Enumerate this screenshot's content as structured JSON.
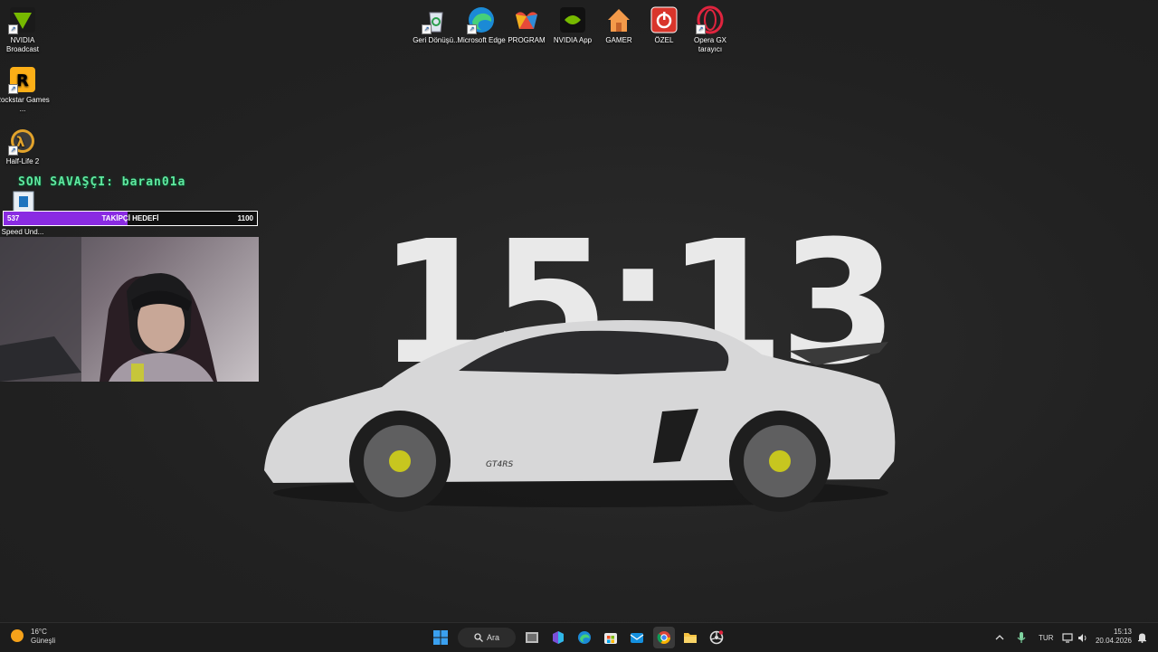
{
  "desktop": {
    "left_icons": [
      {
        "label": "NVIDIA Broadcast",
        "icon": "nvidia-broadcast-icon"
      },
      {
        "label": "Rockstar Games ...",
        "icon": "rockstar-games-icon"
      },
      {
        "label": "Half-Life 2",
        "icon": "half-life-2-icon"
      },
      {
        "label": "Speed Und...",
        "icon": "speed-underground-icon"
      }
    ],
    "top_icons": [
      {
        "label": "Geri Dönüşü...",
        "icon": "recycle-bin-icon"
      },
      {
        "label": "Microsoft Edge",
        "icon": "edge-icon"
      },
      {
        "label": "PROGRAM",
        "icon": "program-folder-icon"
      },
      {
        "label": "NVIDIA App",
        "icon": "nvidia-app-icon"
      },
      {
        "label": "GAMER",
        "icon": "home-folder-icon"
      },
      {
        "label": "ÖZEL",
        "icon": "power-icon"
      },
      {
        "label": "Opera GX tarayıcı",
        "icon": "opera-gx-icon"
      }
    ]
  },
  "wallpaper": {
    "clock": "15:13",
    "car_badge": "GT4RS"
  },
  "stream_overlay": {
    "last_warrior": "SON SAVAŞÇI: baran01a",
    "goal": {
      "label": "TAKİPÇİ HEDEFİ",
      "current": "537",
      "target": "1100",
      "progress": 0.488
    }
  },
  "taskbar": {
    "weather": {
      "temp": "16°C",
      "condition": "Güneşli"
    },
    "search_label": "Ara",
    "apps": [
      "start-icon",
      "search-icon",
      "file-manager-icon",
      "m365-icon",
      "edge-icon",
      "store-icon",
      "outlook-icon",
      "chrome-icon",
      "explorer-icon",
      "wheel-icon"
    ],
    "tray": {
      "language": "TUR",
      "time": "15:13",
      "date": "20.04.2026"
    }
  },
  "colors": {
    "overlay_green": "#5fe9a0",
    "goal_purple": "#8a2be2",
    "background": "#222222"
  }
}
